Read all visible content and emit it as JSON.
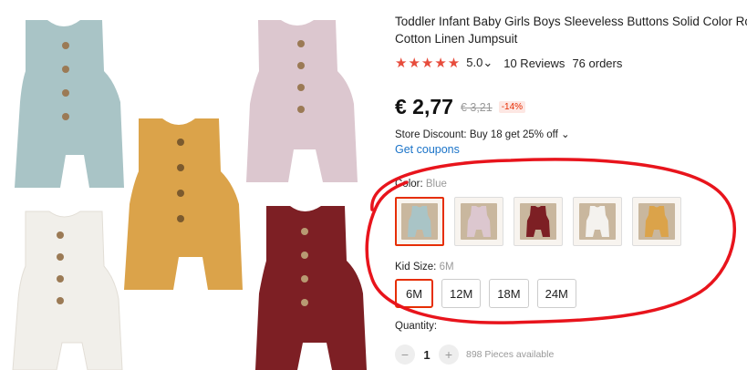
{
  "product": {
    "title_line1": "Toddler Infant Baby Girls Boys Sleeveless Buttons Solid Color Rom",
    "title_line2": "Cotton Linen Jumpsuit",
    "stars": "★★★★★",
    "rating_value": "5.0",
    "rating_caret": "⌄",
    "reviews": "10 Reviews",
    "orders": "76 orders",
    "price": "€ 2,77",
    "old_price": "€ 3,21",
    "discount": "-14%",
    "store_discount": "Store Discount: Buy 18 get 25% off ⌄",
    "coupons": "Get coupons"
  },
  "color": {
    "label": "Color: ",
    "selected": "Blue",
    "options": [
      {
        "name": "blue",
        "hex": "#a9c4c6"
      },
      {
        "name": "pink",
        "hex": "#dcc7cf"
      },
      {
        "name": "burgundy",
        "hex": "#7d1f24"
      },
      {
        "name": "white",
        "hex": "#f1efea"
      },
      {
        "name": "mustard",
        "hex": "#dba34a"
      }
    ]
  },
  "size": {
    "label": "Kid Size: ",
    "selected": "6M",
    "options": [
      "6M",
      "12M",
      "18M",
      "24M"
    ]
  },
  "quantity": {
    "label": "Quantity:",
    "minus": "−",
    "value": "1",
    "plus": "+",
    "available": "898 Pieces available"
  },
  "colors": {
    "accent": "#e62e04",
    "link": "#1a73c8",
    "star": "#e74c3c",
    "annotation": "#e8141c"
  }
}
